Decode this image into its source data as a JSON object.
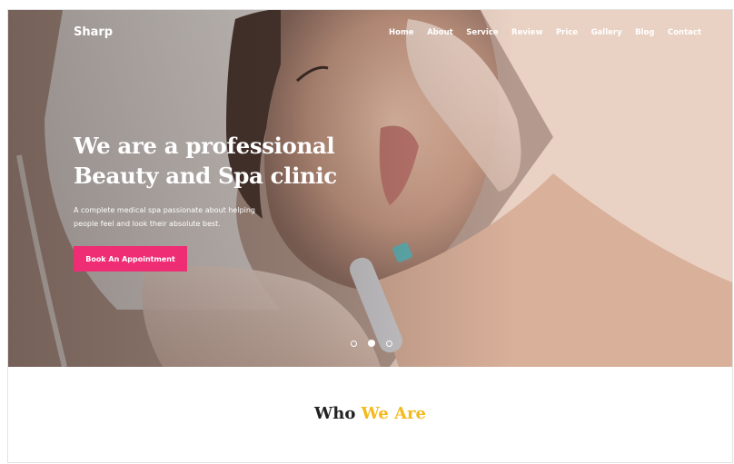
{
  "brand": {
    "name": "Sharp"
  },
  "nav": {
    "items": [
      {
        "label": "Home"
      },
      {
        "label": "About"
      },
      {
        "label": "Service"
      },
      {
        "label": "Review"
      },
      {
        "label": "Price"
      },
      {
        "label": "Gallery"
      },
      {
        "label": "Blog"
      },
      {
        "label": "Contact"
      }
    ]
  },
  "hero": {
    "title_line1": "We are a professional",
    "title_line2": "Beauty and Spa clinic",
    "subtitle_line1": "A complete medical spa passionate about helping",
    "subtitle_line2": "people feel and look their absolute best.",
    "cta_label": "Book An Appointment",
    "slides_total": 3,
    "active_slide": 2
  },
  "who_we_are": {
    "title_part1": "Who",
    "title_part2": "We Are"
  },
  "colors": {
    "accent_pink": "#ee2d74",
    "accent_yellow": "#f5b91d",
    "text_dark": "#222222"
  }
}
